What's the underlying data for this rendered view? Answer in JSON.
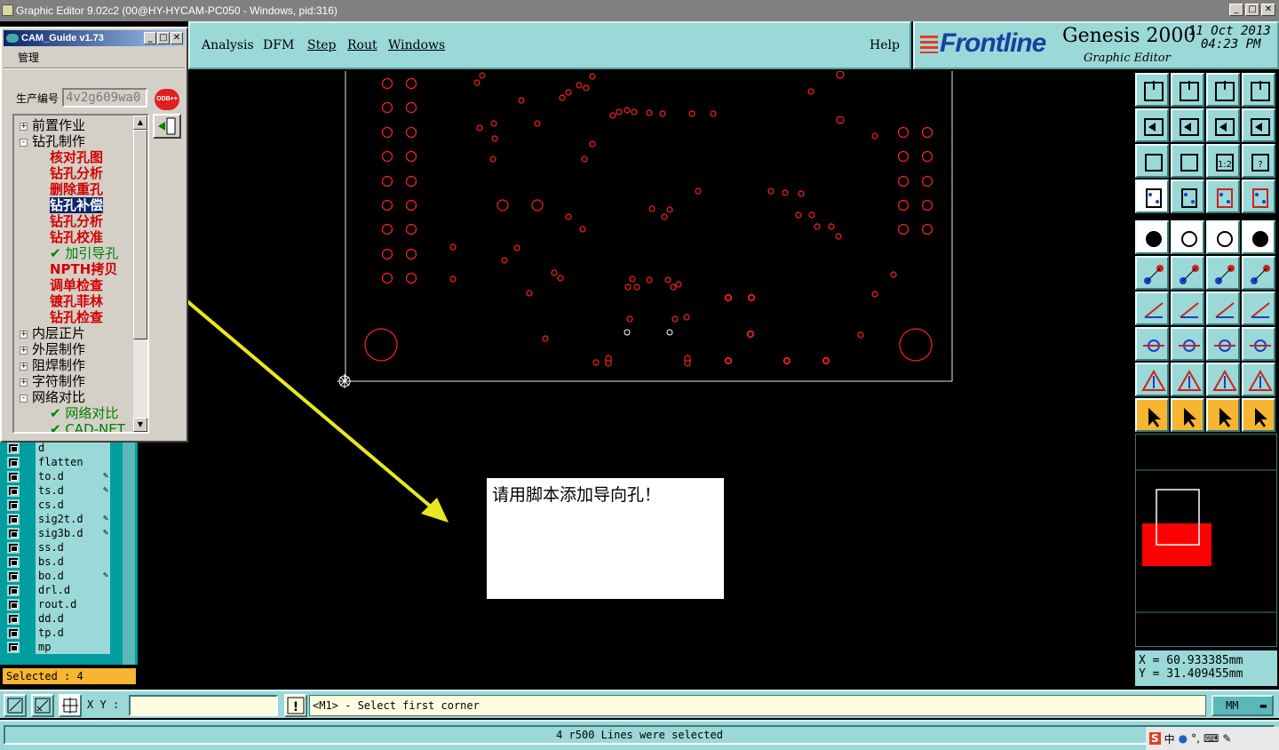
{
  "window": {
    "title": "Graphic Editor 9.02c2 (00@HY-HYCAM-PC050 - Windows, pid:316)"
  },
  "menu": {
    "analysis": "Analysis",
    "dfm": "DFM",
    "step": "Step",
    "rout": "Rout",
    "windows": "Windows",
    "help": "Help"
  },
  "branding": {
    "frontline": "Frontline",
    "product": "Genesis 2000",
    "module": "Graphic Editor",
    "date": "11 Oct 2013",
    "time": "04:23 PM"
  },
  "cam_guide": {
    "title": "CAM_Guide v1.73",
    "menu_manage": "管理",
    "production_no_label": "生产编号",
    "production_no_value": "4v2g609wa0",
    "odb_badge": "ODB++",
    "tree": [
      {
        "label": "前置作业",
        "kind": "top",
        "box": "+"
      },
      {
        "label": "钻孔制作",
        "kind": "top",
        "box": "-"
      },
      {
        "label": "核对孔图",
        "kind": "red"
      },
      {
        "label": "钻孔分析",
        "kind": "red"
      },
      {
        "label": "删除重孔",
        "kind": "red"
      },
      {
        "label": "钻孔补偿",
        "kind": "red-selected"
      },
      {
        "label": "钻孔分析",
        "kind": "red"
      },
      {
        "label": "钻孔校准",
        "kind": "red"
      },
      {
        "label": "✔ 加引导孔",
        "kind": "green"
      },
      {
        "label": "NPTH拷贝",
        "kind": "red"
      },
      {
        "label": "调单检查",
        "kind": "red"
      },
      {
        "label": "镀孔菲林",
        "kind": "red"
      },
      {
        "label": "钻孔检查",
        "kind": "red"
      },
      {
        "label": "内层正片",
        "kind": "top",
        "box": "+"
      },
      {
        "label": "外层制作",
        "kind": "top",
        "box": "+"
      },
      {
        "label": "阻焊制作",
        "kind": "top",
        "box": "+"
      },
      {
        "label": "字符制作",
        "kind": "top",
        "box": "+"
      },
      {
        "label": "网络对比",
        "kind": "top",
        "box": "-"
      },
      {
        "label": "✔ 网络对比",
        "kind": "green"
      },
      {
        "label": "✔ CAD-NET",
        "kind": "green"
      }
    ]
  },
  "layers": [
    {
      "name": "d",
      "pen": false
    },
    {
      "name": "flatten",
      "pen": false
    },
    {
      "name": "to.d",
      "pen": true
    },
    {
      "name": "ts.d",
      "pen": true
    },
    {
      "name": "cs.d",
      "pen": false
    },
    {
      "name": "sig2t.d",
      "pen": true
    },
    {
      "name": "sig3b.d",
      "pen": true
    },
    {
      "name": "ss.d",
      "pen": false
    },
    {
      "name": "bs.d",
      "pen": false
    },
    {
      "name": "bo.d",
      "pen": true
    },
    {
      "name": "drl.d",
      "pen": false
    },
    {
      "name": "rout.d",
      "pen": false
    },
    {
      "name": "dd.d",
      "pen": false
    },
    {
      "name": "tp.d",
      "pen": false
    },
    {
      "name": "mp",
      "pen": false
    }
  ],
  "selected_text": "Selected : 4",
  "message_box": "请用脚本添加导向孔！",
  "command": {
    "xy_label": "X Y :",
    "xy_value": "",
    "prompt": "<M1> - Select first corner",
    "units": "MM"
  },
  "coordinates": {
    "x": "X  =  60.933385mm",
    "y": "Y  =  31.409455mm"
  },
  "status_message": "4 r500 Lines were selected",
  "tray": {
    "ime": "中"
  },
  "colors": {
    "panel": "#9bd8d8",
    "teal": "#009e9e",
    "highlight": "#f7b531",
    "drill": "#ff2020",
    "arrow": "#e8e820"
  }
}
